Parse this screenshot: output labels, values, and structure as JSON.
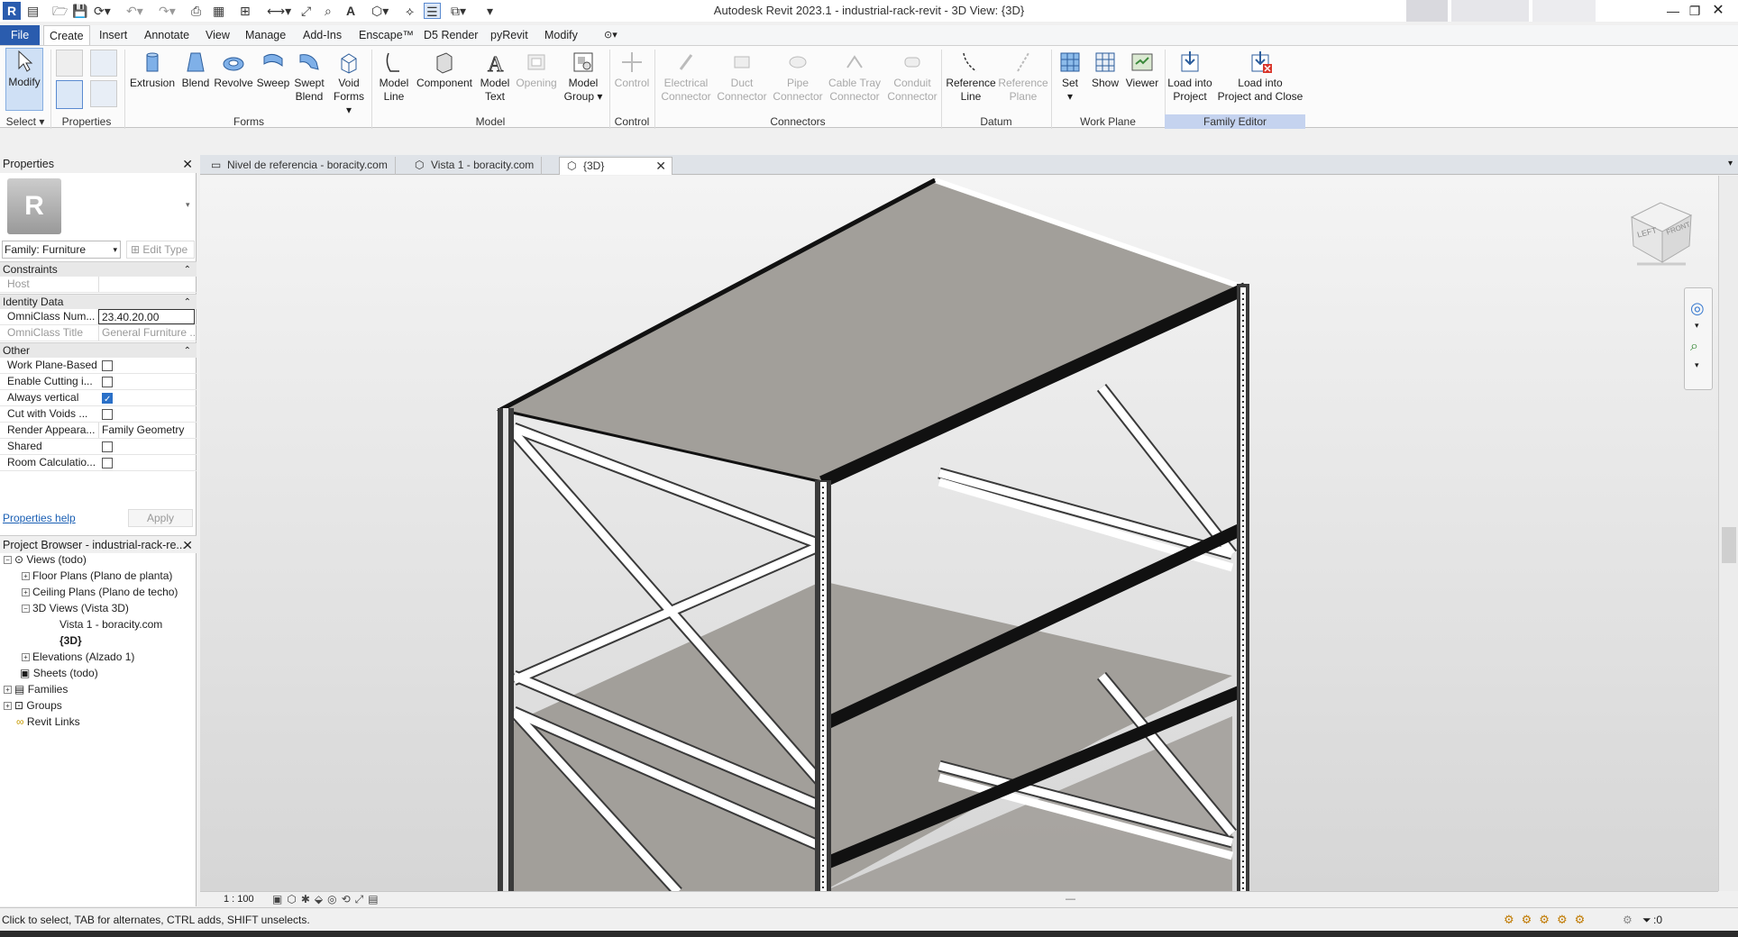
{
  "window": {
    "title": "Autodesk Revit 2023.1 - industrial-rack-revit - 3D View: {3D}",
    "logo": "R"
  },
  "ribbon_tabs": [
    "File",
    "Create",
    "Insert",
    "Annotate",
    "View",
    "Manage",
    "Add-Ins",
    "Enscape™",
    "D5 Render",
    "pyRevit",
    "Modify"
  ],
  "ribbon": {
    "select": {
      "modify": "Modify",
      "label": "Select"
    },
    "properties_panel": "Properties",
    "forms": {
      "label": "Forms",
      "buttons": [
        "Extrusion",
        "Blend",
        "Revolve",
        "Sweep",
        "Swept Blend",
        "Void Forms"
      ]
    },
    "model": {
      "label": "Model",
      "buttons": [
        "Model Line",
        "Component",
        "Model Text",
        "Opening",
        "Model Group"
      ]
    },
    "control": {
      "label": "Control",
      "buttons": [
        "Control"
      ]
    },
    "connectors": {
      "label": "Connectors",
      "buttons": [
        "Electrical Connector",
        "Duct Connector",
        "Pipe Connector",
        "Cable Tray Connector",
        "Conduit Connector"
      ]
    },
    "datum": {
      "label": "Datum",
      "buttons": [
        "Reference Line",
        "Reference Plane"
      ]
    },
    "work_plane": {
      "label": "Work Plane",
      "buttons": [
        "Set",
        "Show",
        "Viewer"
      ]
    },
    "family_editor": {
      "label": "Family Editor",
      "buttons": [
        "Load into Project",
        "Load into Project and Close"
      ]
    }
  },
  "properties": {
    "title": "Properties",
    "type_selector": "Family: Furniture",
    "edit_type": "Edit Type",
    "groups": {
      "constraints": "Constraints",
      "identity": "Identity Data",
      "other": "Other"
    },
    "host": {
      "key": "Host",
      "value": ""
    },
    "omni_num": {
      "key": "OmniClass Num...",
      "value": "23.40.20.00"
    },
    "omni_title": {
      "key": "OmniClass Title",
      "value": "General Furniture ..."
    },
    "other_rows": [
      {
        "key": "Work Plane-Based",
        "checked": false
      },
      {
        "key": "Enable Cutting i...",
        "checked": false
      },
      {
        "key": "Always vertical",
        "checked": true
      },
      {
        "key": "Cut with Voids ...",
        "checked": false
      },
      {
        "key": "Render Appeara...",
        "value": "Family Geometry"
      },
      {
        "key": "Shared",
        "checked": false
      },
      {
        "key": "Room Calculatio...",
        "checked": false
      }
    ],
    "help": "Properties help",
    "apply": "Apply"
  },
  "browser": {
    "title": "Project Browser - industrial-rack-re...",
    "items": [
      "Views (todo)",
      "Floor Plans (Plano de planta)",
      "Ceiling Plans (Plano de techo)",
      "3D Views (Vista 3D)",
      "Vista 1 - boracity.com",
      "{3D}",
      "Elevations (Alzado 1)",
      "Sheets (todo)",
      "Families",
      "Groups",
      "Revit Links"
    ]
  },
  "view_tabs": [
    "Nivel de referencia - boracity.com",
    "Vista 1 - boracity.com",
    "{3D}"
  ],
  "viewcube": {
    "left": "LEFT",
    "front": "FRONT"
  },
  "view_scale": "1 : 100",
  "status": {
    "text": "Click to select, TAB for alternates, CTRL adds, SHIFT unselects.",
    "filter_count": ":0"
  },
  "colors": {
    "accent": "#2a5cae",
    "shelf": "#a29f9a",
    "frame_dark": "#3a3a3a",
    "brace": "#ffffff"
  }
}
